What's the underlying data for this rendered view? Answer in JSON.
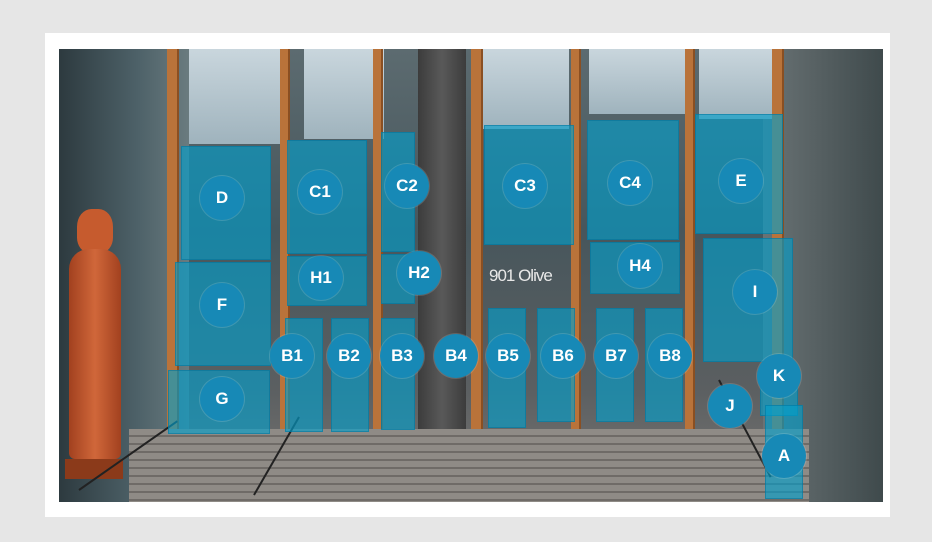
{
  "markers": [
    {
      "label": "D"
    },
    {
      "label": "C1"
    },
    {
      "label": "C2"
    },
    {
      "label": "C3"
    },
    {
      "label": "C4"
    },
    {
      "label": "E"
    },
    {
      "label": "H1"
    },
    {
      "label": "H2"
    },
    {
      "label": "H4"
    },
    {
      "label": "F"
    },
    {
      "label": "I"
    },
    {
      "label": "B1"
    },
    {
      "label": "B2"
    },
    {
      "label": "B3"
    },
    {
      "label": "B4"
    },
    {
      "label": "B5"
    },
    {
      "label": "B6"
    },
    {
      "label": "B7"
    },
    {
      "label": "B8"
    },
    {
      "label": "K"
    },
    {
      "label": "G"
    },
    {
      "label": "J"
    },
    {
      "label": "A"
    }
  ],
  "building": {
    "address_sign": "901 Olive"
  },
  "colors": {
    "marker_fill": "#1789b6",
    "panel_overlay": "#00a0cd",
    "mullion": "#b9733a",
    "border_background": "#e6e6e6"
  }
}
